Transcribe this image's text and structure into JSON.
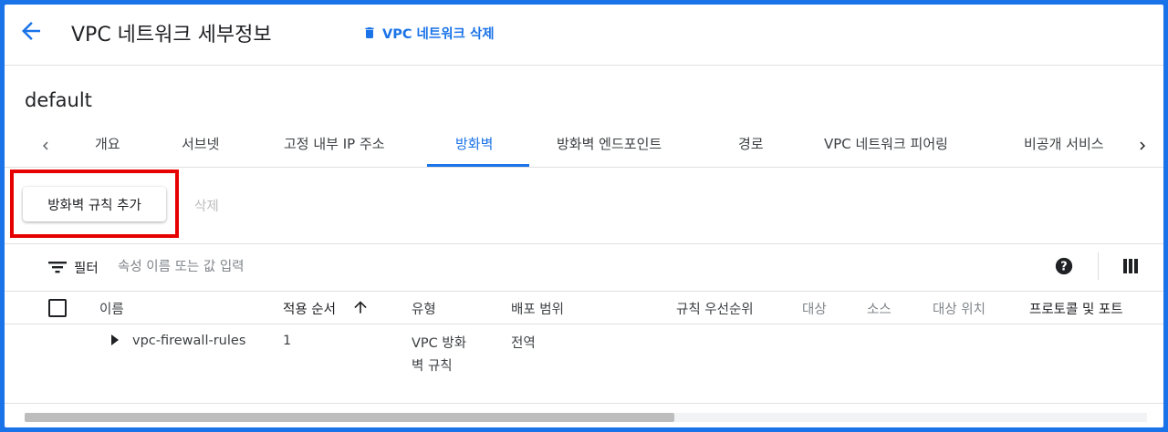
{
  "header": {
    "title": "VPC 네트워크 세부정보",
    "delete_label": "VPC 네트워크 삭제",
    "back_icon": "arrow-back-icon",
    "delete_icon": "trash-icon"
  },
  "network": {
    "name": "default"
  },
  "tabs": [
    {
      "label": "개요",
      "active": false
    },
    {
      "label": "서브넷",
      "active": false
    },
    {
      "label": "고정 내부 IP 주소",
      "active": false
    },
    {
      "label": "방화벽",
      "active": true
    },
    {
      "label": "방화벽 엔드포인트",
      "active": false
    },
    {
      "label": "경로",
      "active": false
    },
    {
      "label": "VPC 네트워크 피어링",
      "active": false
    },
    {
      "label": "비공개 서비스",
      "active": false
    }
  ],
  "toolbar": {
    "add_rule_label": "방화벽 규칙 추가",
    "delete_label": "삭제"
  },
  "filter": {
    "label": "필터",
    "placeholder": "속성 이름 또는 값 입력"
  },
  "table": {
    "columns": [
      "이름",
      "적용 순서",
      "유형",
      "배포 범위",
      "규칙 우선순위",
      "대상",
      "소스",
      "대상 위치",
      "프로토콜 및 포트"
    ],
    "sort_column": "적용 순서",
    "sort_direction": "ascending",
    "rows": [
      {
        "name": "vpc-firewall-rules",
        "order": "1",
        "type": "VPC 방화벽 규칙",
        "scope": "전역"
      }
    ]
  },
  "colors": {
    "accent": "#1a73e8",
    "highlight": "#e60000",
    "border": "#1a73e8"
  }
}
